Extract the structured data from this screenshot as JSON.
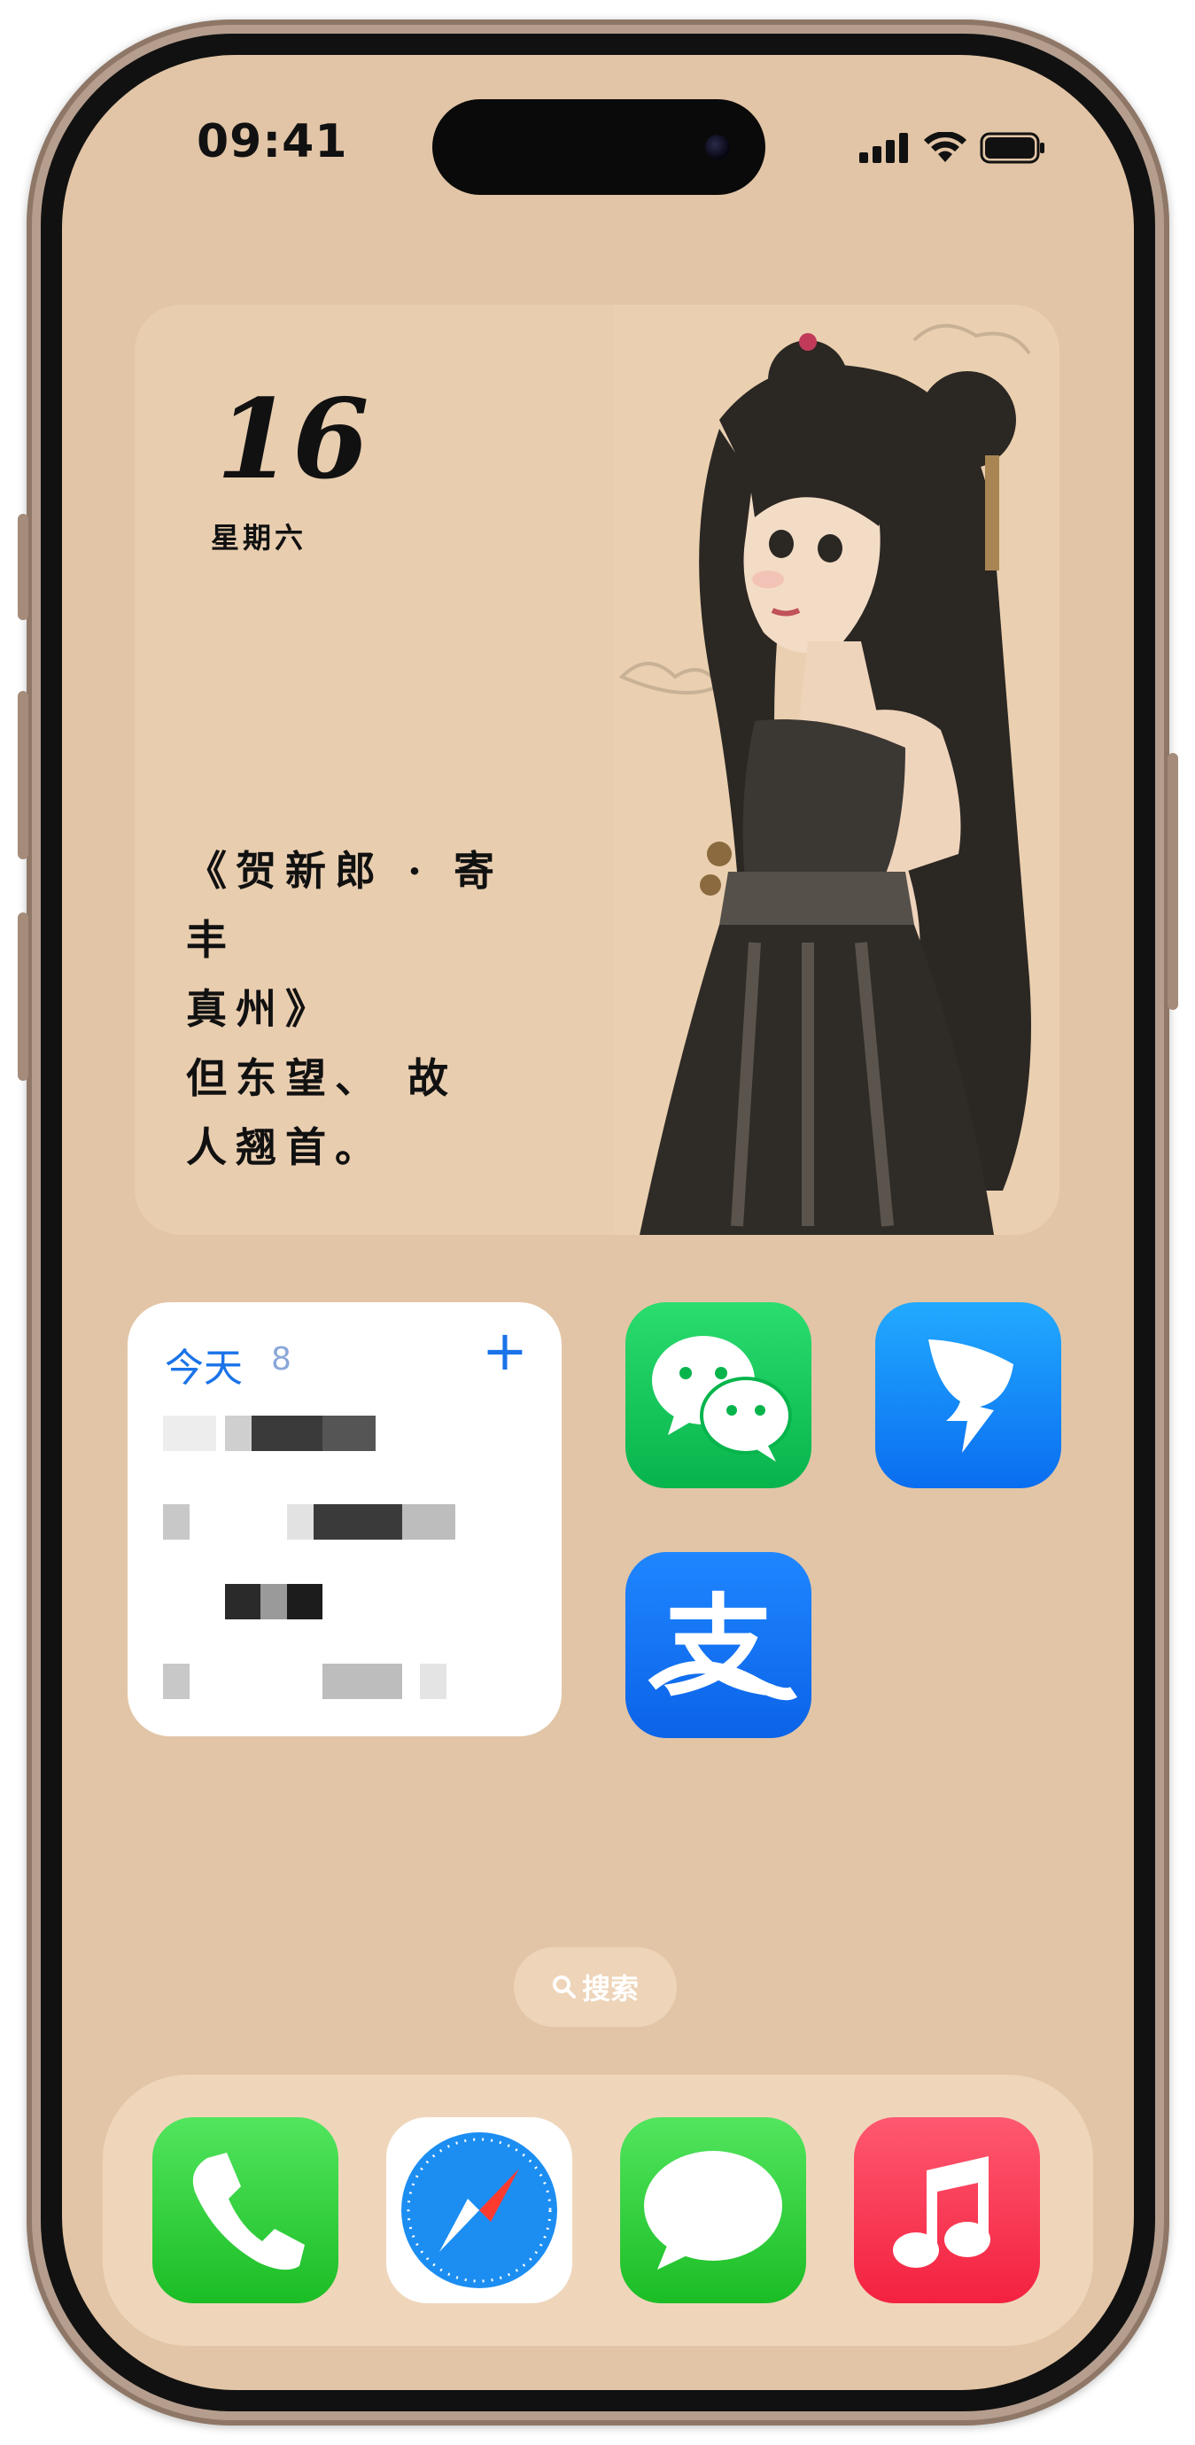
{
  "status_bar": {
    "time": "09:41"
  },
  "photo_widget": {
    "day": "16",
    "weekday": "星期六",
    "poem_lines": [
      "《贺新郎 · 寄丰",
      "真州》",
      "但东望、 故",
      "人翘首。"
    ]
  },
  "reminders_widget": {
    "title": "今天",
    "count": "8",
    "add_symbol": "+"
  },
  "search": {
    "label": "搜索"
  },
  "colors": {
    "wallpaper": "#e2c5a6",
    "accent": "#1a73e8",
    "dock": "#efd6bb"
  },
  "apps": [
    {
      "name": "WeChat",
      "icon": "wechat-icon"
    },
    {
      "name": "DingTalk",
      "icon": "dingtalk-icon"
    },
    {
      "name": "Alipay",
      "icon": "alipay-icon",
      "glyph": "支"
    }
  ],
  "dock": [
    {
      "name": "Phone",
      "icon": "phone-icon"
    },
    {
      "name": "Safari",
      "icon": "safari-icon"
    },
    {
      "name": "Messages",
      "icon": "messages-icon"
    },
    {
      "name": "Music",
      "icon": "music-icon"
    }
  ]
}
